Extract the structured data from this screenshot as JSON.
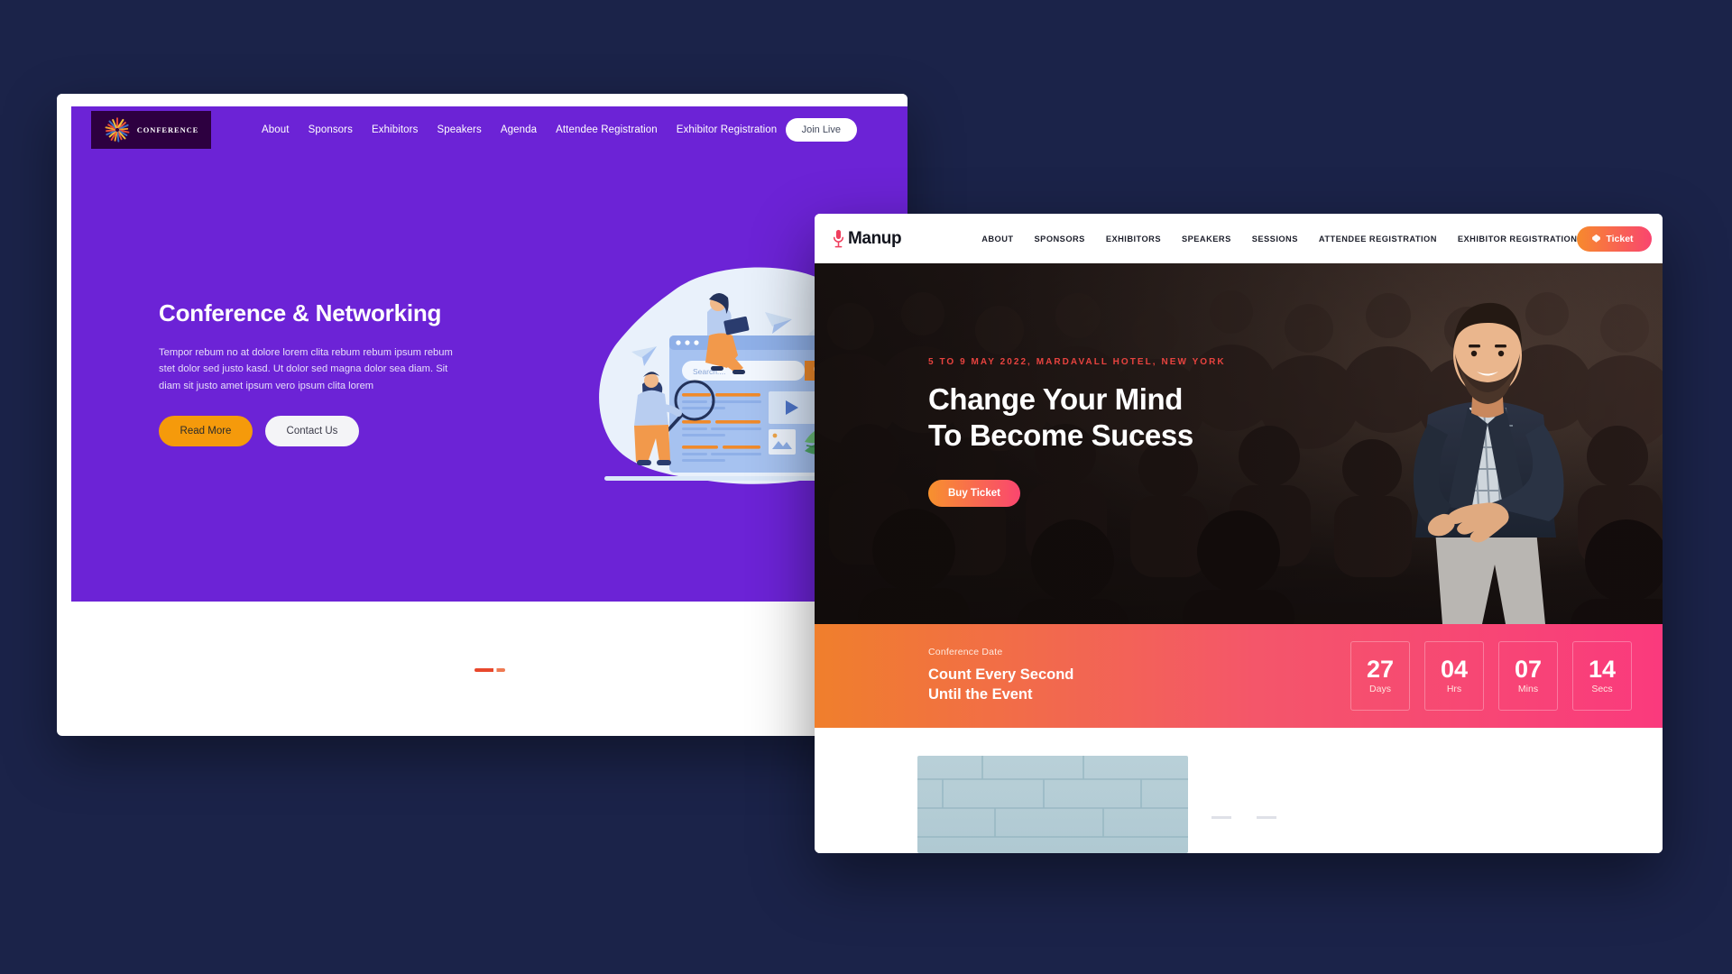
{
  "desktop": {
    "background_color": "#1b2349"
  },
  "window_back": {
    "name": "Conference & Networking website",
    "theme_color": "#6c23d6",
    "logo": {
      "text": "CONFERENCE",
      "icon": "starburst-icon",
      "box_color": "#2d0040"
    },
    "nav": [
      {
        "label": "About"
      },
      {
        "label": "Sponsors"
      },
      {
        "label": "Exhibitors"
      },
      {
        "label": "Speakers"
      },
      {
        "label": "Agenda"
      },
      {
        "label": "Attendee Registration"
      },
      {
        "label": "Exhibitor Registration"
      }
    ],
    "cta": {
      "label": "Join Live"
    },
    "hero": {
      "heading": "Conference & Networking",
      "paragraph": "Tempor rebum no at dolore lorem clita rebum rebum ipsum rebum stet dolor sed justo kasd. Ut dolor sed magna dolor sea diam. Sit diam sit justo amet ipsum vero ipsum clita lorem",
      "primary_button": "Read More",
      "secondary_button": "Contact Us",
      "illustration": {
        "name": "search-browser-illustration",
        "search_placeholder": "Search....",
        "accent_color": "#f08a2a",
        "blue_color": "#7aa0e8"
      }
    }
  },
  "window_front": {
    "name": "Manup conference website",
    "brand": {
      "text": "Manup",
      "icon": "microphone-icon",
      "icon_color": "#ef3f5e"
    },
    "nav": [
      {
        "label": "ABOUT"
      },
      {
        "label": "SPONSORS"
      },
      {
        "label": "EXHIBITORS"
      },
      {
        "label": "SPEAKERS"
      },
      {
        "label": "SESSIONS"
      },
      {
        "label": "ATTENDEE REGISTRATION"
      },
      {
        "label": "EXHIBITOR REGISTRATION"
      }
    ],
    "ticket_button": {
      "label": "Ticket",
      "icon": "ticket-icon",
      "gradient_from": "#f78a2d",
      "gradient_to": "#f9456f"
    },
    "hero": {
      "eyebrow": "5 TO 9 MAY 2022, MARDAVALL HOTEL, NEW YORK",
      "eyebrow_color": "#e8433f",
      "heading_line1": "Change Your Mind",
      "heading_line2": "To Become Sucess",
      "button": "Buy Ticket"
    },
    "countdown": {
      "label": "Conference Date",
      "title_line1": "Count Every Second",
      "title_line2": "Until the Event",
      "gradient_from": "#f07f2c",
      "gradient_to": "#fa3a7d",
      "units": [
        {
          "value": "27",
          "unit": "Days"
        },
        {
          "value": "04",
          "unit": "Hrs"
        },
        {
          "value": "07",
          "unit": "Mins"
        },
        {
          "value": "14",
          "unit": "Secs"
        }
      ]
    }
  }
}
